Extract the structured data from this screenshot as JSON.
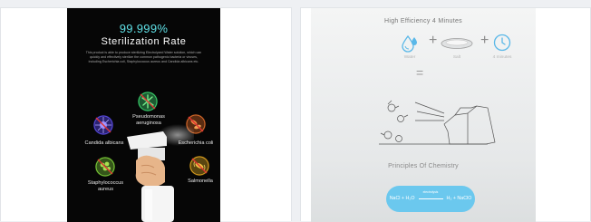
{
  "left_poster": {
    "headline": "99.999%",
    "subhead": "Sterilization Rate",
    "description": "This product is able to produce sterilizing Electrolyzed Water solution, which can quickly and effectively sterilize the common pathogenic bacteria or viruses, including Escherichia coli, Staphylococcus aureus and Candida albicans etc.",
    "bacteria": [
      {
        "label": "Pseudomonas\naeruginosa",
        "color": "#3ad06a"
      },
      {
        "label": "Candida albicans",
        "color": "#5a4ce0"
      },
      {
        "label": "Escherichia coli",
        "color": "#d86a2a"
      },
      {
        "label": "Staphylococcus\naureus",
        "color": "#7ccc3a"
      },
      {
        "label": "Salmonella",
        "color": "#e0a020"
      }
    ]
  },
  "right_poster": {
    "title": "High Efficiency 4 Minutes",
    "ingredients": [
      {
        "label": "Water",
        "icon": "water-drop-icon"
      },
      {
        "label": "Salt",
        "icon": "salt-dish-icon"
      },
      {
        "label": "4 minutes",
        "icon": "clock-icon"
      }
    ],
    "plus": "+",
    "equals": "=",
    "principle_title": "Principles Of Chemistry",
    "formula": {
      "left": "NaCl + H₂O",
      "catalyst": "electrolysis",
      "right": "H₂ + NaClO"
    },
    "accent_color": "#6bc8ee"
  }
}
